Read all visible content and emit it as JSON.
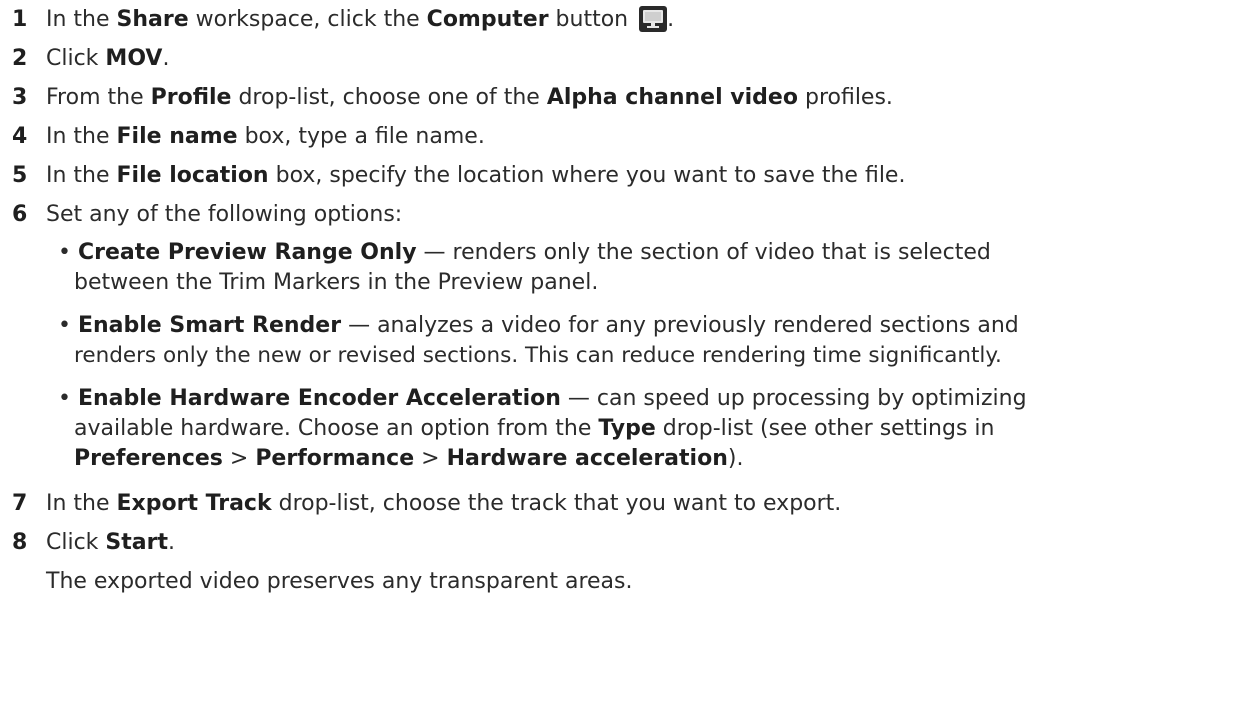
{
  "steps": [
    {
      "number": "1",
      "parts": [
        "In the ",
        "Share",
        " workspace, click the ",
        "Computer",
        " button "
      ],
      "trail": "."
    },
    {
      "number": "2",
      "parts": [
        "Click ",
        "MOV",
        "."
      ]
    },
    {
      "number": "3",
      "parts": [
        "From the ",
        "Profile",
        " drop-list, choose one of the ",
        "Alpha channel video",
        " profiles."
      ]
    },
    {
      "number": "4",
      "parts": [
        "In the ",
        "File name",
        " box, type a file name."
      ]
    },
    {
      "number": "5",
      "parts": [
        "In the ",
        "File location",
        " box, specify the location where you want to save the file."
      ]
    },
    {
      "number": "6",
      "parts": [
        "Set any of the following options:"
      ]
    },
    {
      "number": "7",
      "parts": [
        "In the ",
        "Export Track",
        " drop-list, choose the track that you want to export."
      ]
    },
    {
      "number": "8",
      "parts": [
        "Click ",
        "Start",
        "."
      ]
    }
  ],
  "options": [
    {
      "bullet": "•",
      "term": "Create Preview Range Only",
      "desc": " — renders only the section of video that is selected",
      "cont": [
        "between the Trim Markers in the Preview panel."
      ]
    },
    {
      "bullet": "•",
      "term": "Enable Smart Render",
      "desc": " — analyzes a video for any previously rendered sections and",
      "cont": [
        "renders only the new or revised sections. This can reduce rendering time significantly."
      ]
    },
    {
      "bullet": "•",
      "term": "Enable Hardware Encoder Acceleration",
      "desc": " — can speed up processing by optimizing",
      "cont2a": "available hardware. Choose an option from the ",
      "cont2b": "Type",
      "cont2c": " drop-list (see other settings in",
      "cont3": [
        "Preferences",
        " > ",
        "Performance",
        " > ",
        "Hardware acceleration",
        ")."
      ]
    }
  ],
  "note": "The exported video preserves any transparent areas.",
  "icons": {
    "computer": "computer-monitor-icon"
  }
}
